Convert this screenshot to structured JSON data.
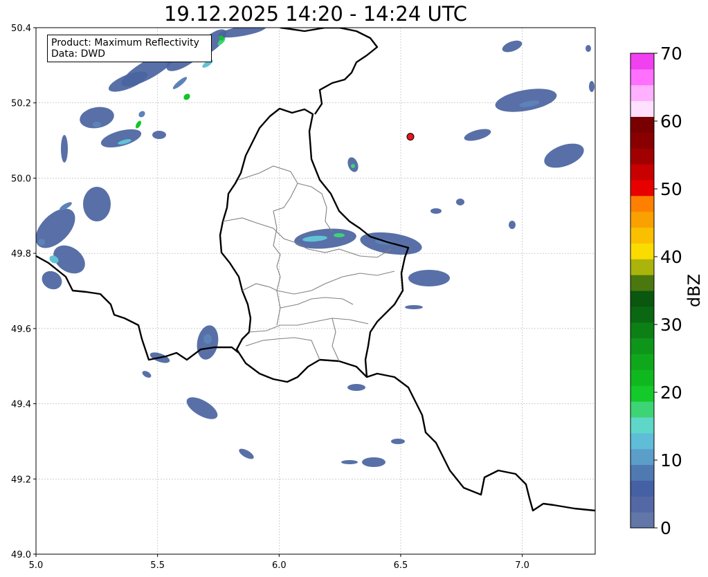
{
  "title": "19.12.2025 14:20 - 14:24 UTC",
  "info_box": {
    "product_line": "Product: Maximum Reflectivity",
    "data_line": "Data: DWD"
  },
  "map": {
    "lon_range": [
      5.0,
      7.3
    ],
    "lat_range": [
      49.0,
      50.4
    ],
    "x_ticks": [
      "5.0",
      "5.5",
      "6.0",
      "6.5",
      "7.0"
    ],
    "x_tick_values": [
      5.0,
      5.5,
      6.0,
      6.5,
      7.0
    ],
    "y_ticks": [
      "49.0",
      "49.2",
      "49.4",
      "49.6",
      "49.8",
      "50.0",
      "50.2",
      "50.4"
    ],
    "y_tick_values": [
      49.0,
      49.2,
      49.4,
      49.6,
      49.8,
      50.0,
      50.2,
      50.4
    ],
    "grid": "dotted",
    "marker": {
      "lon": 6.54,
      "lat": 50.11,
      "color": "#e8141e"
    },
    "rain_colors": [
      "#4a64a0",
      "#5d82b8",
      "#62c2d6",
      "#3dd475",
      "#13c42a"
    ]
  },
  "colorbar": {
    "label": "dBZ",
    "range": [
      0,
      70
    ],
    "tick_labels": [
      "0",
      "10",
      "20",
      "30",
      "40",
      "50",
      "60",
      "70"
    ],
    "tick_values": [
      0,
      10,
      20,
      30,
      40,
      50,
      60,
      70
    ],
    "colors": [
      "#6276a8",
      "#5468a5",
      "#4560a4",
      "#4f79b1",
      "#5a9ec9",
      "#5fbdd8",
      "#5fd7c8",
      "#3dd475",
      "#14c92a",
      "#10b81f",
      "#0fa81c",
      "#0e961a",
      "#0c7f15",
      "#0a6812",
      "#0a570f",
      "#4a780f",
      "#aab40a",
      "#fadc00",
      "#fac000",
      "#faa000",
      "#ff8000",
      "#e80000",
      "#c80000",
      "#a00000",
      "#880000",
      "#780000",
      "#ffe0ff",
      "#ffb0ff",
      "#ff70ff",
      "#f040f0"
    ]
  }
}
